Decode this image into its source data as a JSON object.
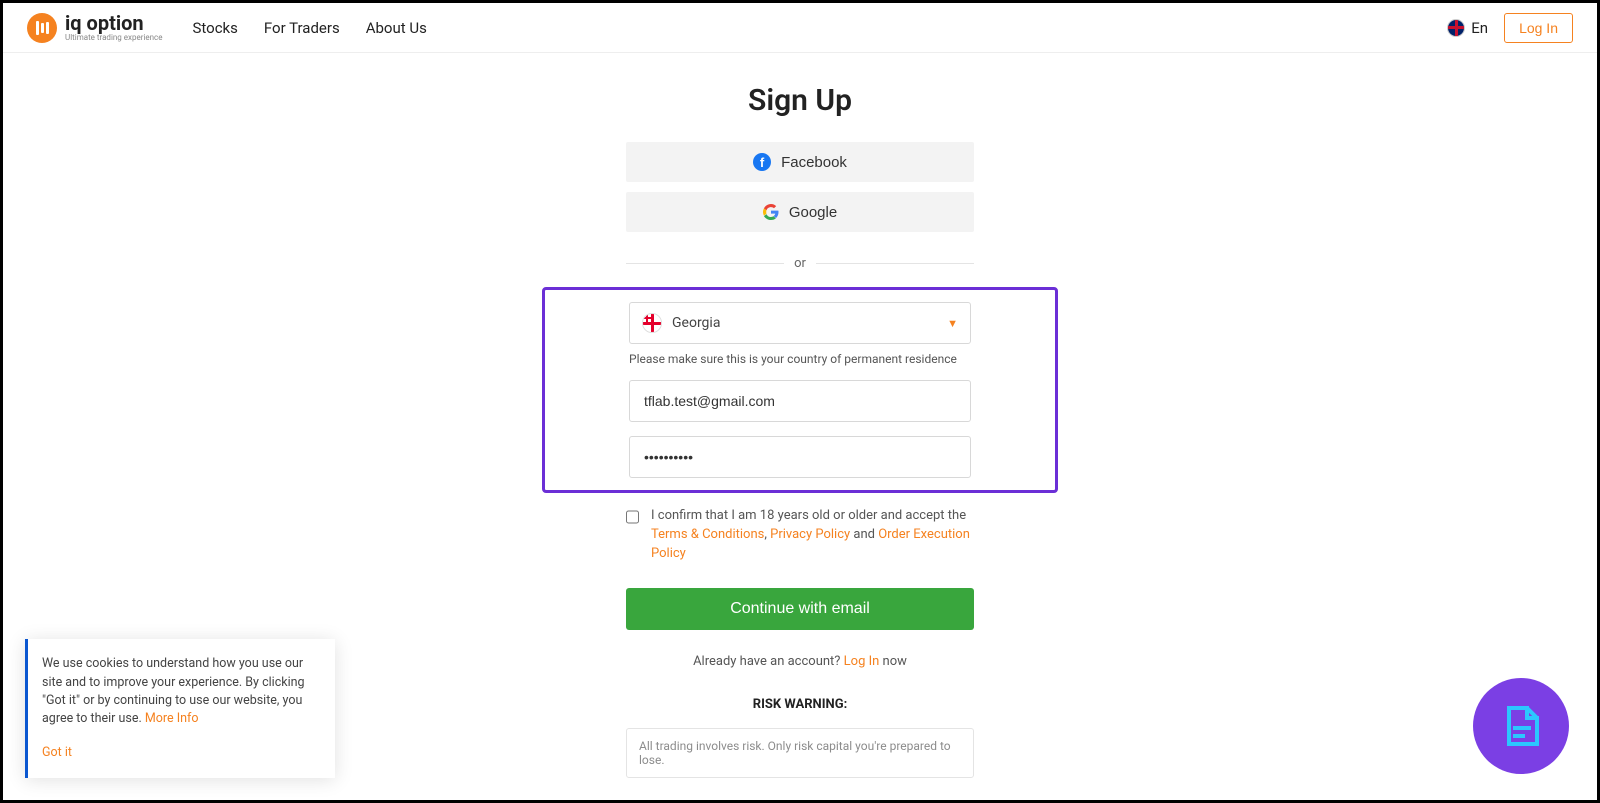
{
  "header": {
    "brand": "iq option",
    "tagline": "Ultimate trading experience",
    "nav": [
      "Stocks",
      "For Traders",
      "About Us"
    ],
    "lang": "En",
    "login": "Log In"
  },
  "signup": {
    "title": "Sign Up",
    "facebook": "Facebook",
    "google": "Google",
    "or": "or",
    "country": "Georgia",
    "country_hint": "Please make sure this is your country of permanent residence",
    "email": "tflab.test@gmail.com",
    "password": "••••••••••",
    "consent_prefix": "I confirm that I am 18 years old or older and accept the ",
    "terms": "Terms & Conditions",
    "comma": ", ",
    "privacy": "Privacy Policy",
    "and": " and ",
    "order_exec": "Order Execution Policy",
    "submit": "Continue with email",
    "already_prefix": "Already have an account? ",
    "login_link": "Log In",
    "already_suffix": " now",
    "risk_title": "RISK WARNING:",
    "risk_text": "All trading involves risk. Only risk capital you're prepared to lose."
  },
  "cookie": {
    "text": "We use cookies to understand how you use our site and to improve your experience. By clicking \"Got it\" or by continuing to use our website, you agree to their use. ",
    "more": "More Info",
    "gotit": "Got it"
  }
}
